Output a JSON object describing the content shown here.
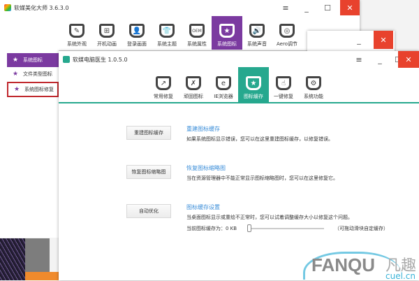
{
  "back_window": {
    "title": "软媒美化大师 3.6.3.0",
    "tools": [
      {
        "label": "系统外观",
        "icon": "✎"
      },
      {
        "label": "开机动画",
        "icon": "⊞"
      },
      {
        "label": "登录画面",
        "icon": "👤"
      },
      {
        "label": "系统主题",
        "icon": "👕"
      },
      {
        "label": "系统属性",
        "icon": "OEM"
      },
      {
        "label": "系统图标",
        "icon": "★"
      },
      {
        "label": "系统声音",
        "icon": "🔊"
      },
      {
        "label": "Aero调节",
        "icon": "◎"
      }
    ],
    "selected": 5
  },
  "sidebar": {
    "items": [
      {
        "label": "系统图标",
        "icon": "★"
      },
      {
        "label": "文件类型图标",
        "icon": "★"
      },
      {
        "label": "系统图标修复",
        "icon": "★"
      }
    ]
  },
  "front_window": {
    "title": "软媒电脑医生 1.0.5.0",
    "tools": [
      {
        "label": "常用修复",
        "icon": "↗"
      },
      {
        "label": "顽固图标",
        "icon": "✗"
      },
      {
        "label": "IE浏览器",
        "icon": "e"
      },
      {
        "label": "图标缓存",
        "icon": "★"
      },
      {
        "label": "一键修复",
        "icon": "☝"
      },
      {
        "label": "系统功能",
        "icon": "⚙"
      }
    ],
    "selected": 3
  },
  "sections": [
    {
      "button": "重建图标缓存",
      "title": "重建图标缓存",
      "desc": "如果系统图标显示错误，您可以在这里重建图标缓存，以修复错误。"
    },
    {
      "button": "恢复图标缩略图",
      "title": "恢复图标缩略图",
      "desc": "当在资源管理器中不能正常显示图标缩略图时，您可以在这里修复它。"
    },
    {
      "button": "自动优化",
      "title": "图标缓存设置",
      "desc": "当桌面图标显示或重绘不正常时，您可以试着调整缓存大小以修复这个问题。"
    }
  ],
  "cache": {
    "label": "当前图标缓存为：0 KB",
    "hint": "（可拖动滑块自定缓存）",
    "slider_value": 0
  },
  "watermark": {
    "brand": "FANQU",
    "cn": "凡趣",
    "domain": "cuel.cn"
  },
  "colors": {
    "purple": "#7b3aa0",
    "teal": "#26a88e",
    "close": "#e8422d",
    "link": "#3a8dd8"
  }
}
